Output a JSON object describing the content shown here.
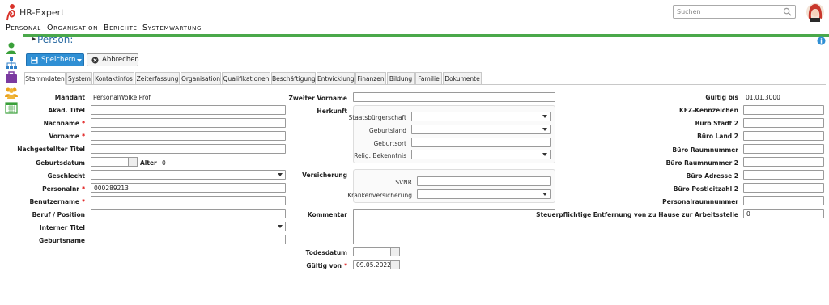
{
  "app": {
    "title": "HR-Expert"
  },
  "search": {
    "placeholder": "Suchen"
  },
  "menu": {
    "items": [
      "Personal",
      "Organisation",
      "Berichte",
      "Systemwartung"
    ]
  },
  "page": {
    "title": "Person:"
  },
  "toolbar": {
    "save_label": "Speichern",
    "cancel_label": "Abbrechen"
  },
  "tabs": [
    "Stammdaten",
    "System",
    "Kontaktinfos",
    "Zeiterfassung",
    "Organisation",
    "Qualifikationen",
    "Beschäftigung",
    "Entwicklung",
    "Finanzen",
    "Bildung",
    "Familie",
    "Dokumente"
  ],
  "col1": {
    "mandant_label": "Mandant",
    "mandant_value": "PersonalWolke Prof",
    "akad_titel": "Akad. Titel",
    "nachname": "Nachname",
    "vorname": "Vorname",
    "nachgestellter_titel": "Nachgestellter Titel",
    "geburtsdatum": "Geburtsdatum",
    "alter_label": "Alter",
    "alter_value": "0",
    "geschlecht": "Geschlecht",
    "personalnr": "Personalnr",
    "personalnr_value": "000289213",
    "benutzername": "Benutzername",
    "beruf": "Beruf / Position",
    "interner_titel": "Interner Titel",
    "geburtsname": "Geburtsname",
    "required_mark": "*"
  },
  "col2": {
    "zweiter_vorname": "Zweiter Vorname",
    "herkunft": "Herkunft",
    "staatsbuergerschaft": "Staatsbürgerschaft",
    "geburtsland": "Geburtsland",
    "geburtsort": "Geburtsort",
    "bekenntnis": "Relig. Bekenntnis",
    "versicherung": "Versicherung",
    "svnr": "SVNR",
    "krankenversicherung": "Krankenversicherung",
    "kommentar": "Kommentar",
    "todesdatum": "Todesdatum",
    "gueltig_von": "Gültig von",
    "gueltig_von_value": "09.05.2022"
  },
  "col3": {
    "gueltig_bis": "Gültig bis",
    "gueltig_bis_value": "01.01.3000",
    "kfz": "KFZ-Kennzeichen",
    "buero_stadt2": "Büro Stadt 2",
    "buero_land2": "Büro Land 2",
    "buero_raumnummer": "Büro Raumnummer",
    "buero_raumnummer2": "Büro Raumnummer 2",
    "buero_adresse2": "Büro Adresse 2",
    "buero_postleitzahl2": "Büro Postleitzahl 2",
    "personalraumnummer": "Personalraumnummer",
    "entfernung": "Steuerpflichtige Entfernung von zu Hause zur Arbeitsstelle",
    "entfernung_value": "0"
  },
  "colors": {
    "accent": "#2f8fd4",
    "green": "#4aa84a",
    "link": "#2e6da4",
    "required": "#dd0000"
  },
  "sidebar_icons": [
    "person-icon",
    "org-chart-icon",
    "briefcase-icon",
    "group-icon",
    "calendar-icon"
  ]
}
